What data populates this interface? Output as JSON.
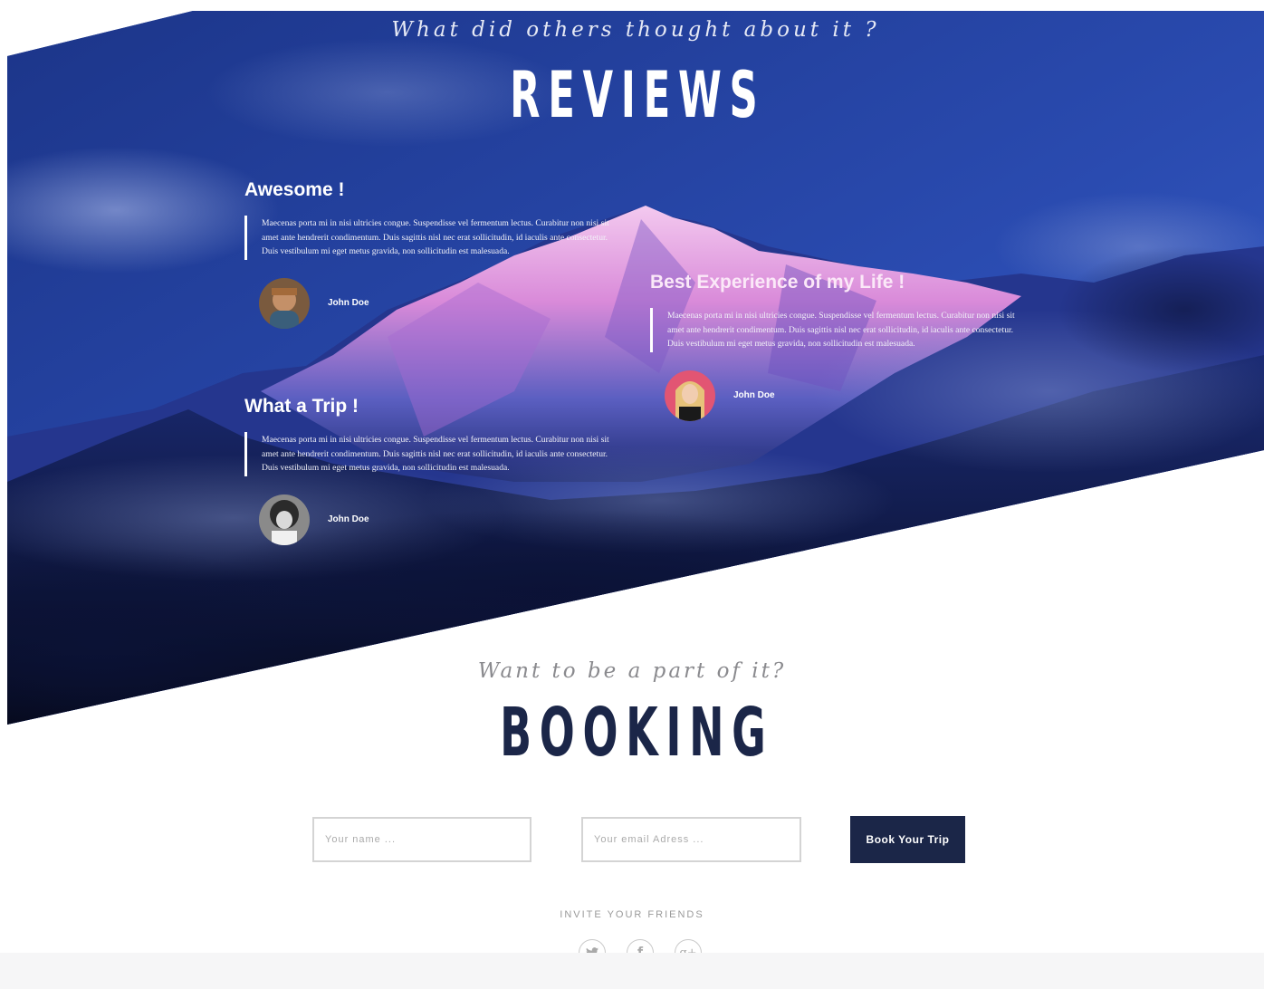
{
  "reviews_section": {
    "subtitle": "What did others thought about it ?",
    "title": "REVIEWS",
    "items": [
      {
        "heading": "Awesome !",
        "text": "Maecenas porta mi in nisi ultricies congue. Suspendisse vel fermentum lectus. Curabitur non nisi sit amet ante hendrerit condimentum. Duis sagittis nisl nec erat sollicitudin, id iaculis ante consectetur. Duis vestibulum mi eget metus gravida, non sollicitudin est malesuada.",
        "author": "John Doe"
      },
      {
        "heading": "Best Experience of my Life !",
        "text": "Maecenas porta mi in nisi ultricies congue. Suspendisse vel fermentum lectus. Curabitur non nisi sit amet ante hendrerit condimentum. Duis sagittis nisl nec erat sollicitudin, id iaculis ante consectetur. Duis vestibulum mi eget metus gravida, non sollicitudin est malesuada.",
        "author": "John Doe"
      },
      {
        "heading": "What a Trip !",
        "text": "Maecenas porta mi in nisi ultricies congue. Suspendisse vel fermentum lectus. Curabitur non nisi sit amet ante hendrerit condimentum. Duis sagittis nisl nec erat sollicitudin, id iaculis ante consectetur. Duis vestibulum mi eget metus gravida, non sollicitudin est malesuada.",
        "author": "John Doe"
      }
    ]
  },
  "booking_section": {
    "subtitle": "Want to be a part of it?",
    "title": "BOOKING",
    "name_placeholder": "Your name ...",
    "email_placeholder": "Your email Adress ...",
    "button_label": "Book Your Trip",
    "invite_label": "INVITE YOUR FRIENDS",
    "social_icons": [
      "twitter-icon",
      "facebook-icon",
      "google-plus-icon"
    ],
    "facebook_glyph": "f",
    "gplus_glyph": "g+"
  },
  "colors": {
    "hero_sky": "#2a4bb0",
    "navy": "#1b2648",
    "mountain_pink": "#e9a6e6"
  }
}
